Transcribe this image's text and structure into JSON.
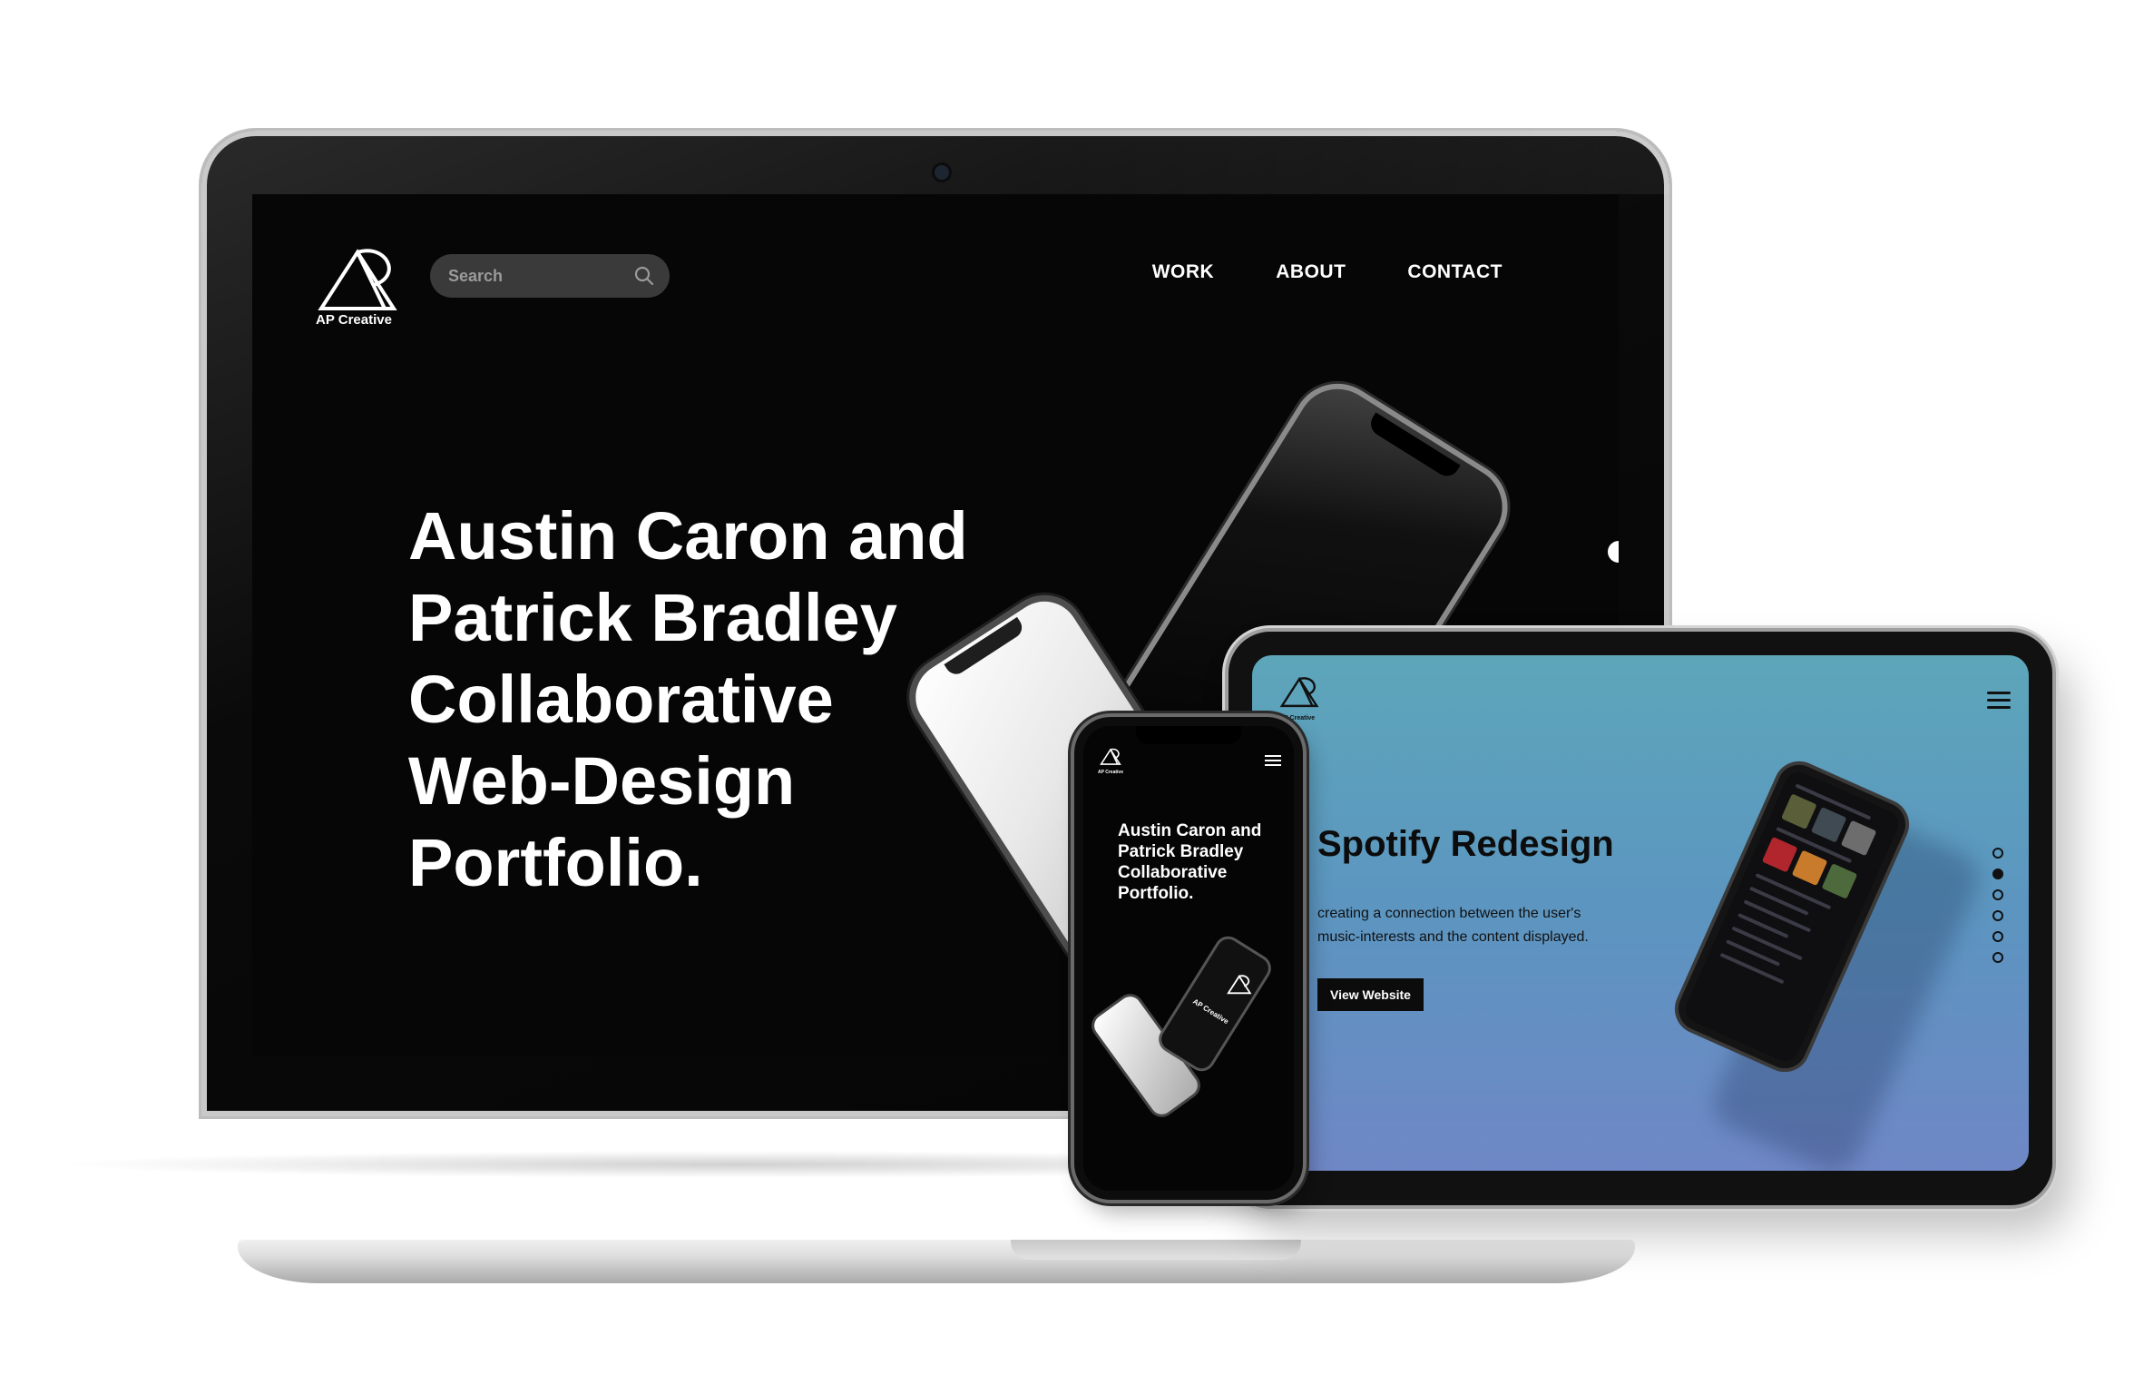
{
  "brand": {
    "name": "AP Creative"
  },
  "laptop": {
    "search": {
      "placeholder": "Search"
    },
    "nav": [
      {
        "label": "WORK"
      },
      {
        "label": "ABOUT"
      },
      {
        "label": "CONTACT"
      }
    ],
    "hero_lines": [
      "Austin Caron and",
      "Patrick Bradley",
      "Collaborative",
      "Web-Design",
      "Portfolio."
    ]
  },
  "phone": {
    "hero_lines": [
      "Austin Caron and",
      "Patrick Bradley",
      "Collaborative",
      "Portfolio."
    ],
    "mockup_text": "AP Creative",
    "mockup_text_partial": "AP Cre"
  },
  "tablet": {
    "title": "Spotify Redesign",
    "description": "creating a connection between the user's music-interests and the content displayed.",
    "button_label": "View Website",
    "pagination": {
      "count": 6,
      "active_index": 1
    }
  },
  "colors": {
    "background": "#ffffff",
    "laptop_screen": "#060606",
    "tablet_gradient_top": "#5da6ba",
    "tablet_gradient_bottom": "#6f87c6",
    "accent_dark": "#0c0c0c"
  }
}
